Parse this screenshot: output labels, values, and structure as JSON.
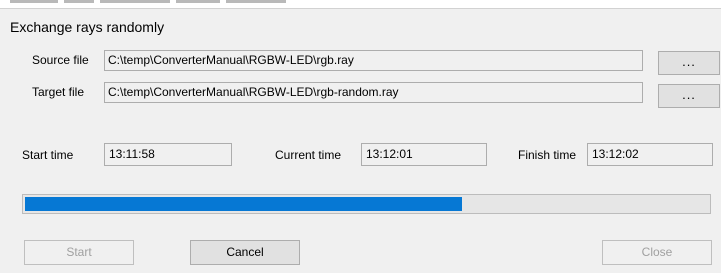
{
  "dialog": {
    "title": "Exchange rays randomly"
  },
  "source": {
    "label": "Source file",
    "path": "C:\\temp\\ConverterManual\\RGBW-LED\\rgb.ray",
    "browse_label": "..."
  },
  "target": {
    "label": "Target file",
    "path": "C:\\temp\\ConverterManual\\RGBW-LED\\rgb-random.ray",
    "browse_label": "..."
  },
  "times": {
    "start_label": "Start time",
    "start_value": "13:11:58",
    "current_label": "Current time",
    "current_value": "13:12:01",
    "finish_label": "Finish time",
    "finish_value": "13:12:02"
  },
  "progress": {
    "fraction": 0.64,
    "fill_color": "#0678d4"
  },
  "buttons": {
    "start_label": "Start",
    "start_enabled": false,
    "cancel_label": "Cancel",
    "cancel_enabled": true,
    "close_label": "Close",
    "close_enabled": false
  }
}
